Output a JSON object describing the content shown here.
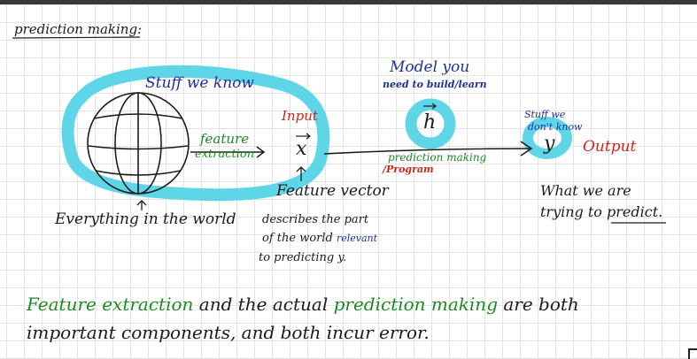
{
  "title": "prediction making:",
  "labels": {
    "stuff_we_know": "Stuff we know",
    "everything": "Everything in the world",
    "feature_extraction_1": "feature",
    "feature_extraction_2": "extraction",
    "input": "Input",
    "x_symbol": "x",
    "feature_vector": "Feature vector",
    "fv_desc_1": "describes the part",
    "fv_desc_2a": "of the world",
    "fv_desc_2b": "relevant",
    "fv_desc_3": "to predicting y.",
    "model_1": "Model you",
    "model_2": "need to build/learn",
    "h_symbol": "h",
    "prediction_making": "prediction making",
    "program": "/Program",
    "stuff_dont_know_1": "Stuff we",
    "stuff_dont_know_2": "don't know",
    "y_symbol": "y",
    "output": "Output",
    "what_predict_1": "What we are",
    "what_predict_2a": "trying to",
    "what_predict_2b": "predict."
  },
  "summary": {
    "line1_a": "Feature extraction",
    "line1_b": "and the actual",
    "line1_c": "prediction making",
    "line1_d": "are both",
    "line2": "important components, and both incur error."
  },
  "colors": {
    "highlight": "#5fd6e8",
    "ink_black": "#1b1b1b",
    "ink_blue": "#1f2f9a",
    "ink_red": "#d6231b",
    "ink_green": "#1d8a22"
  }
}
